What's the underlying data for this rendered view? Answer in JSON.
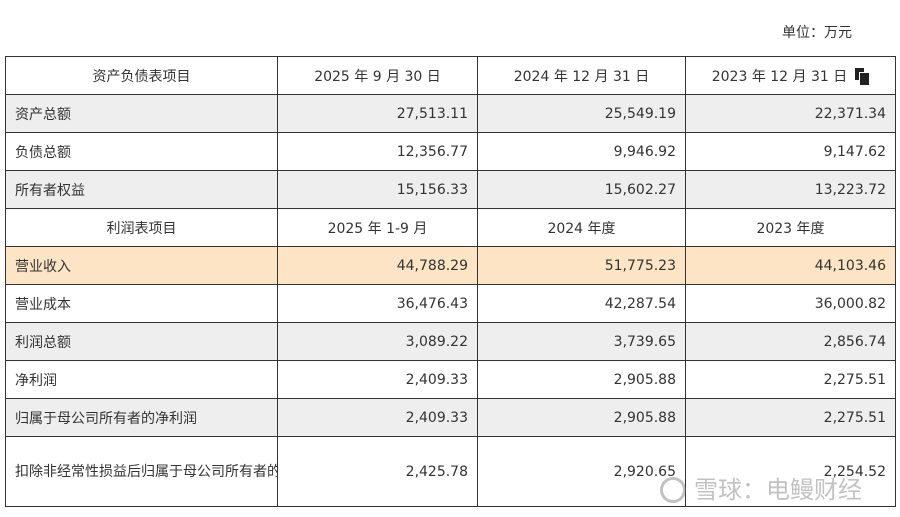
{
  "unit_label": "单位：万元",
  "balance_header": {
    "item": "资产负债表项目",
    "col1": "2025 年 9 月 30 日",
    "col2": "2024 年 12 月 31 日",
    "col3": "2023 年 12 月 31 日"
  },
  "balance_rows": [
    {
      "label": "资产总额",
      "v1": "27,513.11",
      "v2": "25,549.19",
      "v3": "22,371.34"
    },
    {
      "label": "负债总额",
      "v1": "12,356.77",
      "v2": "9,946.92",
      "v3": "9,147.62"
    },
    {
      "label": "所有者权益",
      "v1": "15,156.33",
      "v2": "15,602.27",
      "v3": "13,223.72"
    }
  ],
  "income_header": {
    "item": "利润表项目",
    "col1": "2025 年 1-9 月",
    "col2": "2024 年度",
    "col3": "2023 年度"
  },
  "income_rows": [
    {
      "label": "营业收入",
      "v1": "44,788.29",
      "v2": "51,775.23",
      "v3": "44,103.46"
    },
    {
      "label": "营业成本",
      "v1": "36,476.43",
      "v2": "42,287.54",
      "v3": "36,000.82"
    },
    {
      "label": "利润总额",
      "v1": "3,089.22",
      "v2": "3,739.65",
      "v3": "2,856.74"
    },
    {
      "label": "净利润",
      "v1": "2,409.33",
      "v2": "2,905.88",
      "v3": "2,275.51"
    },
    {
      "label": "归属于母公司所有者的净利润",
      "v1": "2,409.33",
      "v2": "2,905.88",
      "v3": "2,275.51"
    },
    {
      "label": "扣除非经常性损益后归属于母公司所有者的净利润",
      "v1": "2,425.78",
      "v2": "2,920.65",
      "v3": "2,254.52"
    }
  ],
  "watermark": {
    "text": "雪球：电鳗财经"
  },
  "icons": {
    "copy": "copy-icon",
    "watermark_logo": "snowball-logo-icon"
  }
}
